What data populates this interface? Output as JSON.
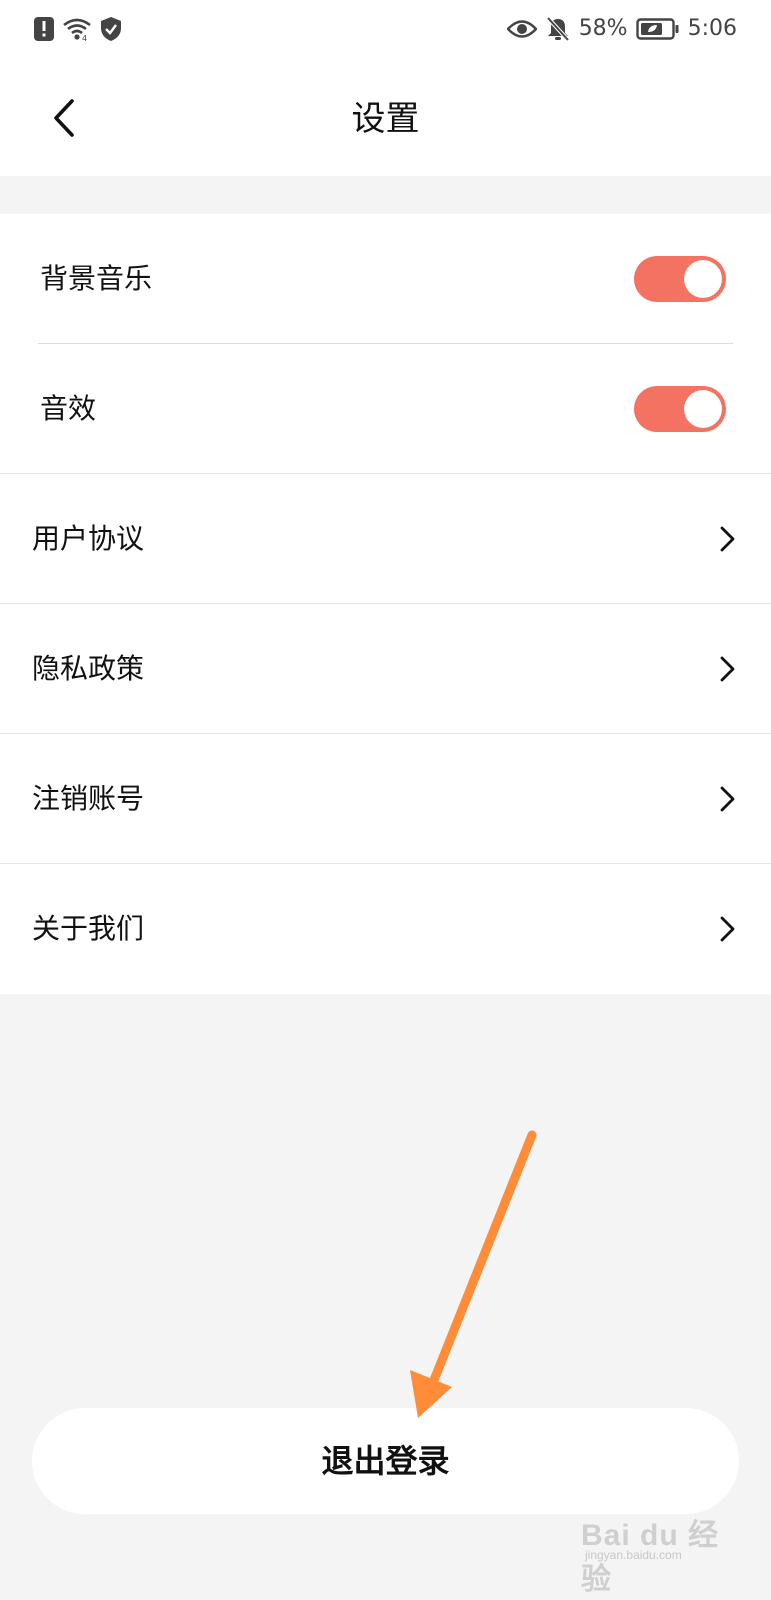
{
  "status_bar": {
    "battery_percent": "58%",
    "time": "5:06",
    "icons_left": [
      "alert-icon",
      "wifi-icon",
      "shield-icon"
    ],
    "icons_right": [
      "eye-icon",
      "bell-off-icon",
      "battery-icon"
    ]
  },
  "header": {
    "title": "设置",
    "back_icon": "chevron-left-icon"
  },
  "settings": {
    "items": [
      {
        "label": "背景音乐",
        "type": "toggle",
        "on": true
      },
      {
        "label": "音效",
        "type": "toggle",
        "on": true
      },
      {
        "label": "用户协议",
        "type": "link"
      },
      {
        "label": "隐私政策",
        "type": "link"
      },
      {
        "label": "注销账号",
        "type": "link"
      },
      {
        "label": "关于我们",
        "type": "link"
      }
    ]
  },
  "logout": {
    "label": "退出登录"
  },
  "annotation": {
    "color": "#ff8c38",
    "icon": "arrow-icon"
  },
  "colors": {
    "toggle_on": "#f47262",
    "background": "#f4f4f4"
  },
  "watermark": {
    "text": "Bai du 经验",
    "sub": "jingyan.baidu.com"
  }
}
